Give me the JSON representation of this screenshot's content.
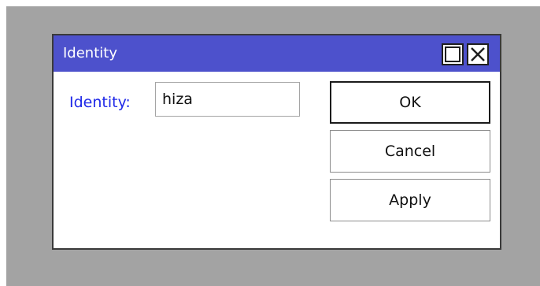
{
  "dialog": {
    "title": "Identity",
    "titlebar_color": "#4d51cc",
    "controls": {
      "restore_icon": "restore-icon",
      "close_icon": "close-icon"
    }
  },
  "form": {
    "identity_label": "Identity:",
    "identity_label_color": "#1f28e8",
    "identity_value": "hiza"
  },
  "buttons": {
    "ok_label": "OK",
    "cancel_label": "Cancel",
    "apply_label": "Apply"
  }
}
